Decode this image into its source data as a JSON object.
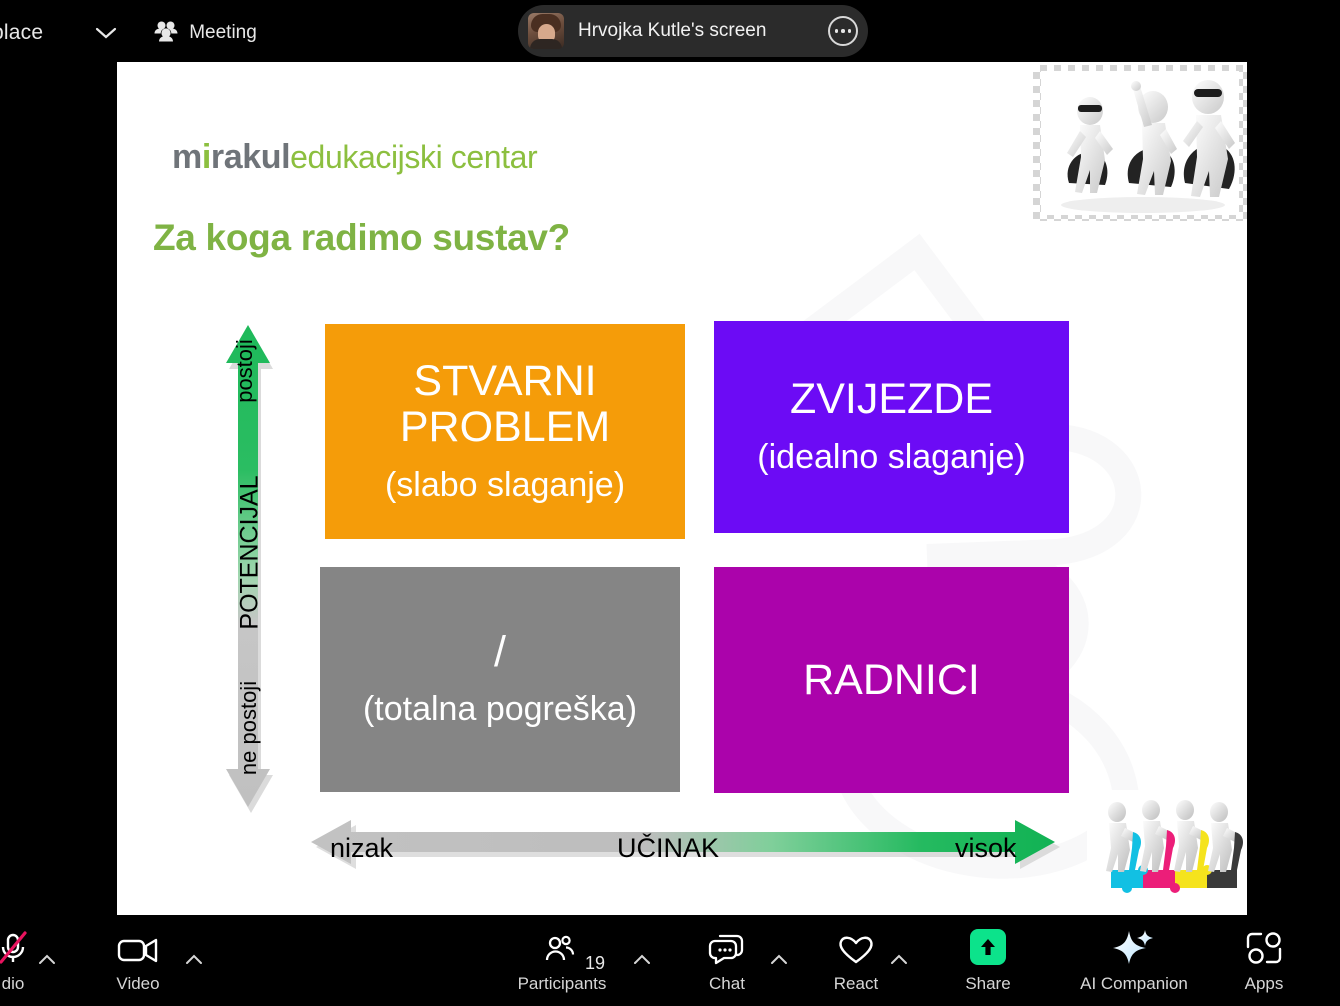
{
  "topbar": {
    "app_label": "place",
    "meeting_label": "Meeting",
    "share_banner": "Hrvojka Kutle's screen"
  },
  "slide": {
    "logo": {
      "brand_mi": "mi",
      "brand_i_dot": "",
      "brand_rest": "rakul",
      "tagline": "edukacijski centar"
    },
    "title": "Za koga radimo sustav?",
    "vertical_axis": {
      "top_label": "postoji",
      "axis_label": "POTENCIJAL",
      "bottom_label": "ne postoji"
    },
    "horizontal_axis": {
      "left_label": "nizak",
      "axis_label": "UČINAK",
      "right_label": "visok"
    },
    "quadrants": [
      {
        "id": "stvarni-problem",
        "title": "STVARNI",
        "title2": "PROBLEM",
        "subtitle": "(slabo slaganje)",
        "color": "#f59c09"
      },
      {
        "id": "zvijezde",
        "title": "ZVIJEZDE",
        "title2": "",
        "subtitle": "(idealno slaganje)",
        "color": "#6c0bf5"
      },
      {
        "id": "totalna-pogreska",
        "title": "/",
        "title2": "",
        "subtitle": "(totalna pogreška)",
        "color": "#858585"
      },
      {
        "id": "radnici",
        "title": "RADNICI",
        "title2": "",
        "subtitle": "",
        "color": "#ab03ab"
      }
    ]
  },
  "toolbar": {
    "audio_label": "dio",
    "video_label": "Video",
    "participants_label": "Participants",
    "participants_count": "19",
    "chat_label": "Chat",
    "react_label": "React",
    "share_label": "Share",
    "ai_companion_label": "AI Companion",
    "apps_label": "Apps"
  },
  "colors": {
    "brand_green": "#7fb344",
    "logo_gray": "#6f7479",
    "accent_green": "#0ce38b",
    "mute_red": "#e8135e"
  }
}
